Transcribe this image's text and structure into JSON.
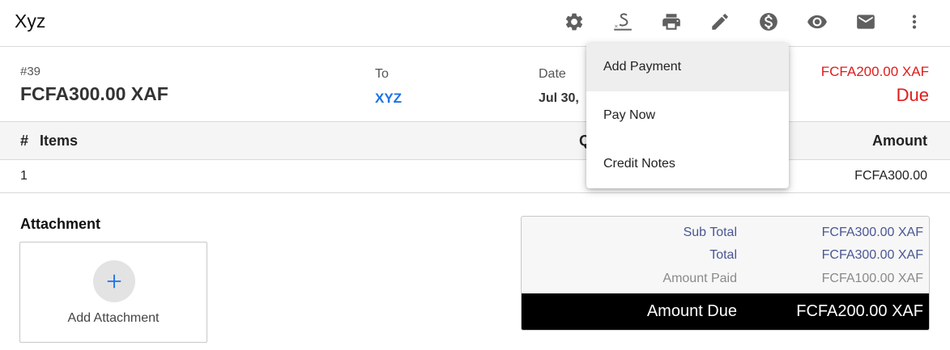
{
  "header": {
    "title": "Xyz",
    "icons": [
      "gear-icon",
      "signature-icon",
      "print-icon",
      "pencil-icon",
      "dollar-icon",
      "eye-icon",
      "mail-icon",
      "more-vert-icon"
    ],
    "signature_glyph": "×"
  },
  "invoice": {
    "number": "#39",
    "total": "FCFA300.00 XAF",
    "to_label": "To",
    "to_value": "XYZ",
    "date_label": "Date",
    "date_value": "Jul 30,",
    "due_amount": "FCFA200.00 XAF",
    "due_label": "Due"
  },
  "table": {
    "headers": {
      "number": "#",
      "items": "Items",
      "qty": "Q",
      "amount": "Amount"
    },
    "rows": [
      {
        "number": "1",
        "amount": "FCFA300.00"
      }
    ]
  },
  "attachment": {
    "title": "Attachment",
    "add_label": "Add Attachment"
  },
  "totals": {
    "sub_total_label": "Sub Total",
    "sub_total_value": "FCFA300.00 XAF",
    "total_label": "Total",
    "total_value": "FCFA300.00 XAF",
    "amount_paid_label": "Amount Paid",
    "amount_paid_value": "FCFA100.00 XAF",
    "amount_due_label": "Amount Due",
    "amount_due_value": "FCFA200.00 XAF"
  },
  "menu": {
    "items": [
      {
        "label": "Add Payment",
        "active": true
      },
      {
        "label": "Pay Now",
        "active": false
      },
      {
        "label": "Credit Notes",
        "active": false
      }
    ]
  },
  "colors": {
    "accent_link": "#1a73e8",
    "due_red": "#e01b1b",
    "totals_label_blue": "#4a5694",
    "amount_due_bar": "#000000",
    "icon_gray": "#5f5f5f"
  }
}
